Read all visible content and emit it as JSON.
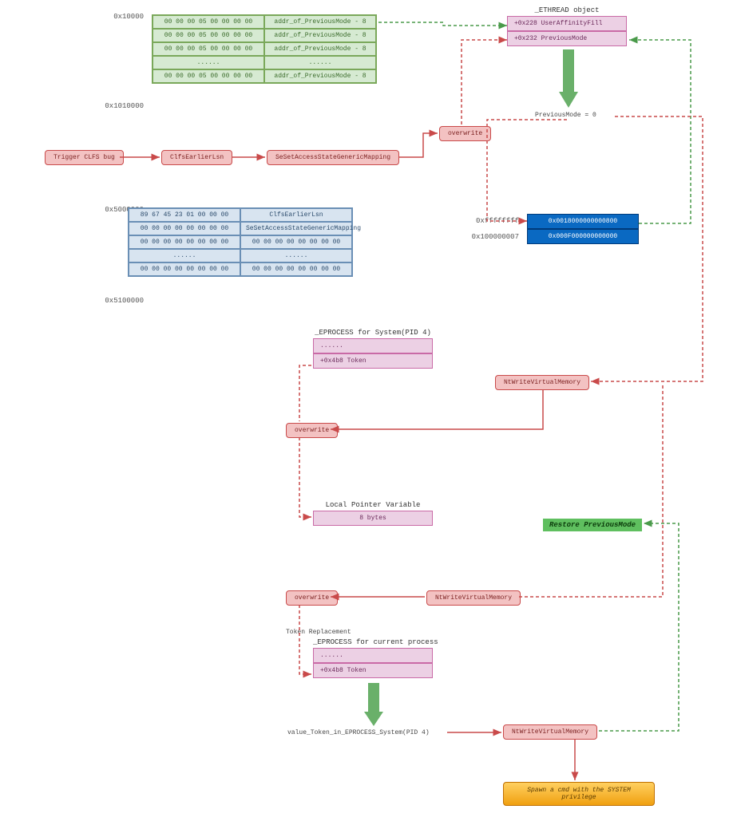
{
  "addresses": {
    "a1": "0x10000",
    "a2": "0x1010000",
    "a3": "0x5000000",
    "a4": "0x5100000",
    "b1": "0xffffffff",
    "b2": "0x100000007"
  },
  "green_rows": [
    {
      "hex": "00 00 00 05 00 00 00 00",
      "label": "addr_of_PreviousMode - 8"
    },
    {
      "hex": "00 00 00 05 00 00 00 00",
      "label": "addr_of_PreviousMode - 8"
    },
    {
      "hex": "00 00 00 05 00 00 00 00",
      "label": "addr_of_PreviousMode - 8"
    },
    {
      "hex": "......",
      "label": "......"
    },
    {
      "hex": "00 00 00 05 00 00 00 00",
      "label": "addr_of_PreviousMode - 8"
    }
  ],
  "lblue_rows": [
    {
      "hex": "89 67 45 23 01 00 00 00",
      "label": "ClfsEarlierLsn"
    },
    {
      "hex": "00 00 00 00 00 00 00 00",
      "label": "SeSetAccessStateGenericMapping"
    },
    {
      "hex": "00 00 00 00 00 00 00 00",
      "label": "00 00 00 00 00 00 00 00"
    },
    {
      "hex": "......",
      "label": "......"
    },
    {
      "hex": "00 00 00 00 00 00 00 00",
      "label": "00 00 00 00 00 00 00 00"
    }
  ],
  "ethread": {
    "title": "_ETHREAD object",
    "rows": [
      "+0x228 UserAffinityFill",
      "+0x232 PreviousMode"
    ],
    "pmode_label": "PreviousMode = 0"
  },
  "eproc_sys": {
    "title": "_EPROCESS for System(PID 4)",
    "rows": [
      "......",
      "+0x4b8 Token"
    ]
  },
  "ptrvar": {
    "title": "Local Pointer Variable",
    "row": "8 bytes"
  },
  "eproc_cur": {
    "title": "_EPROCESS for current process",
    "pre": "Token Replacement",
    "rows": [
      "......",
      "+0x4b8 Token"
    ]
  },
  "blue_rows": [
    "0x0018000000000800",
    "0x000F000000000000"
  ],
  "actions": {
    "trigger": "Trigger CLFS bug",
    "clfs": "ClfsEarlierLsn",
    "seset": "SeSetAccessStateGenericMapping",
    "ow1": "overwrite",
    "nt1": "NtWriteVirtualMemory",
    "ow2": "overwrite",
    "nt2": "NtWriteVirtualMemory",
    "ow3": "overwrite",
    "nt3": "NtWriteVirtualMemory"
  },
  "value_label": "value_Token_in_EPROCESS_System(PID 4)",
  "restore_label": "Restore PreviousMode",
  "final": "Spawn a cmd with the SYSTEM privilege",
  "colors": {
    "red": "#c94a4a",
    "green": "#4a9a4a",
    "blue": "#0a69c2"
  }
}
